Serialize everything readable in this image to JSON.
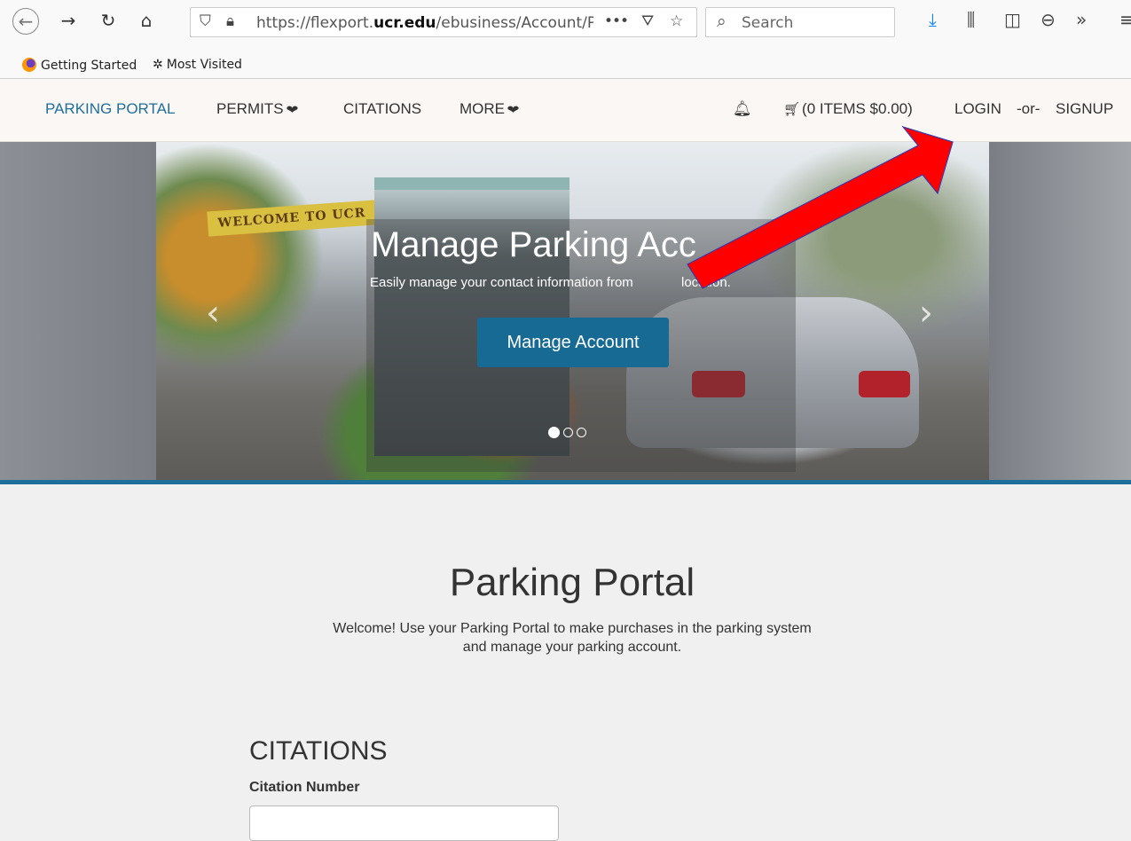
{
  "browser": {
    "url_prefix": "https://flexport.",
    "url_domain": "ucr.edu",
    "url_path": "/ebusiness/Account/Porta",
    "search_placeholder": "Search",
    "bookmarks": [
      "Getting Started",
      "Most Visited"
    ]
  },
  "nav": {
    "brand": "PARKING PORTAL",
    "permits": "PERMITS",
    "citations": "CITATIONS",
    "more": "MORE",
    "cart": "(0 ITEMS $0.00)",
    "login": "LOGIN",
    "or": "-or-",
    "signup": "SIGNUP"
  },
  "hero": {
    "banner": "WELCOME TO UCR",
    "title": "Manage Parking Acc",
    "subtitle": "Easily manage your contact information from",
    "subtitle_end": "location.",
    "button": "Manage Account",
    "slide_count": 3,
    "active_slide": 1
  },
  "main": {
    "title": "Parking Portal",
    "subtitle": "Welcome! Use your Parking Portal to make purchases in the parking system and manage your parking account.",
    "citations_heading": "CITATIONS",
    "citation_label": "Citation Number",
    "citation_value": ""
  },
  "colors": {
    "accent": "#1f6f9b",
    "button": "#166a93",
    "annotation_arrow": "#ff0000"
  }
}
